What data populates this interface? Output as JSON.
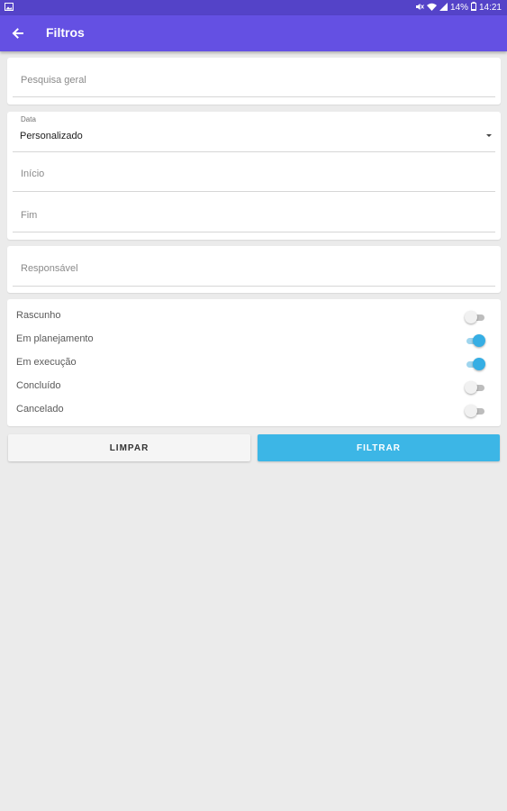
{
  "status_bar": {
    "battery": "14%",
    "time": "14:21",
    "left_icon": "image-icon",
    "icons": [
      "mute-icon",
      "wifi-icon",
      "signal-icon",
      "battery-icon"
    ]
  },
  "app_bar": {
    "title": "Filtros",
    "back_icon": "arrow-left-icon",
    "color": "#6450e3"
  },
  "search": {
    "placeholder": "Pesquisa geral"
  },
  "date_filter": {
    "label": "Data",
    "selected": "Personalizado",
    "start_placeholder": "Início",
    "end_placeholder": "Fim"
  },
  "responsible": {
    "placeholder": "Responsável"
  },
  "status_switches": [
    {
      "label": "Rascunho",
      "on": false
    },
    {
      "label": "Em planejamento",
      "on": true
    },
    {
      "label": "Em execução",
      "on": true
    },
    {
      "label": "Concluído",
      "on": false
    },
    {
      "label": "Cancelado",
      "on": false
    }
  ],
  "actions": {
    "clear_label": "LIMPAR",
    "filter_label": "FILTRAR",
    "filter_color": "#3cb6e6"
  }
}
